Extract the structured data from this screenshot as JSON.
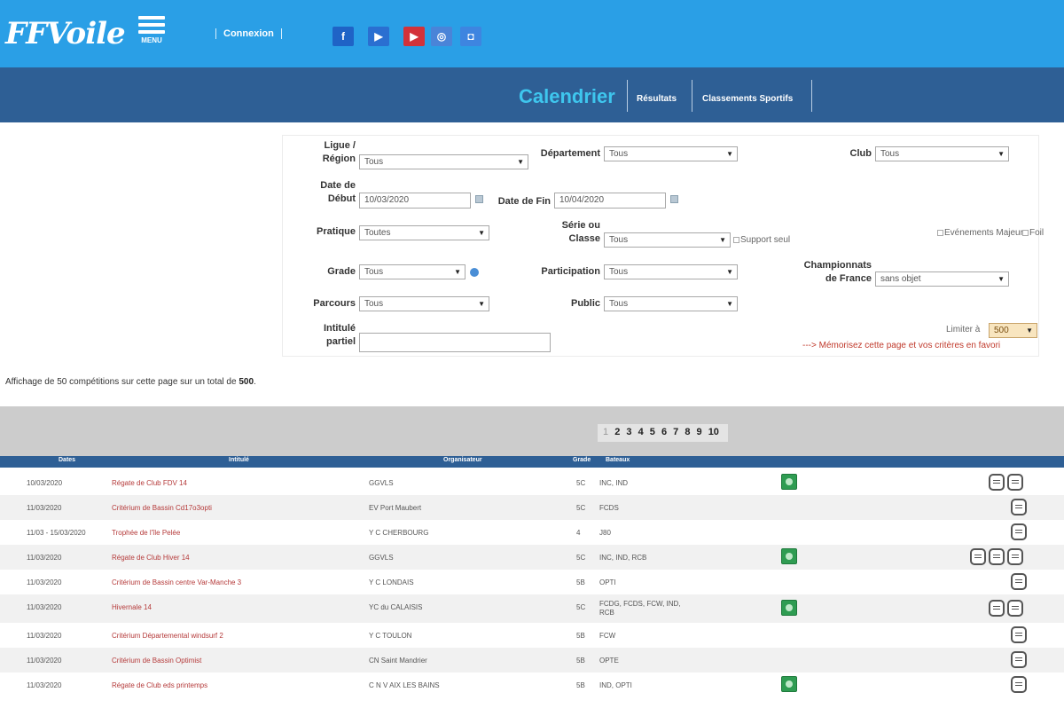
{
  "header": {
    "logo": "FFVoile",
    "menu_label": "MENU",
    "connexion": "Connexion",
    "social": [
      "f",
      "t",
      "yt",
      "ig",
      "dm"
    ]
  },
  "nav": {
    "calendrier": "Calendrier",
    "resultats": "Résultats",
    "classements": "Classements Sportifs"
  },
  "filters": {
    "ligue_label_1": "Ligue /",
    "ligue_label_2": "Région",
    "ligue_value": "Tous",
    "departement_label": "Département",
    "departement_value": "Tous",
    "club_label": "Club",
    "club_value": "Tous",
    "date_debut_label_1": "Date de",
    "date_debut_label_2": "Début",
    "date_debut_value": "10/03/2020",
    "date_fin_label": "Date de Fin",
    "date_fin_value": "10/04/2020",
    "pratique_label": "Pratique",
    "pratique_value": "Toutes",
    "serie_label_1": "Série ou",
    "serie_label_2": "Classe",
    "serie_value": "Tous",
    "support_seul": "Support seul",
    "evenements_majeurs": "Evénements Majeurs",
    "foil": "Foil",
    "grade_label": "Grade",
    "grade_value": "Tous",
    "participation_label": "Participation",
    "participation_value": "Tous",
    "championnats_label_1": "Championnats",
    "championnats_label_2": "de France",
    "championnats_value": "sans objet",
    "parcours_label": "Parcours",
    "parcours_value": "Tous",
    "public_label": "Public",
    "public_value": "Tous",
    "intitule_label_1": "Intitulé",
    "intitule_label_2": "partiel",
    "intitule_value": "",
    "limiter_label": "Limiter à",
    "limiter_value": "500",
    "memorisez": "---> Mémorisez cette page et vos critères en favori"
  },
  "summary": {
    "prefix": "Affichage de 50 compétitions sur cette page sur un total de",
    "total": "500",
    "suffix": "."
  },
  "pagination": [
    "1",
    "2",
    "3",
    "4",
    "5",
    "6",
    "7",
    "8",
    "9",
    "10"
  ],
  "table": {
    "headers": {
      "dates": "Dates",
      "intitule": "Intitulé",
      "organisateur": "Organisateur",
      "grade": "Grade",
      "bateaux": "Bateaux"
    },
    "rows": [
      {
        "date": "10/03/2020",
        "title": "Régate de Club FDV 14",
        "org": "GGVLS",
        "grade": "5C",
        "boats": "INC, IND"
      },
      {
        "date": "11/03/2020",
        "title": "Critérium de Bassin Cd17o3opti",
        "org": "EV Port Maubert",
        "grade": "5C",
        "boats": "FCDS"
      },
      {
        "date": "11/03 - 15/03/2020",
        "title": "Trophée de l'île Pelée",
        "org": "Y C CHERBOURG",
        "grade": "4",
        "boats": "J80"
      },
      {
        "date": "11/03/2020",
        "title": "Régate de Club Hiver 14",
        "org": "GGVLS",
        "grade": "5C",
        "boats": "INC, IND, RCB"
      },
      {
        "date": "11/03/2020",
        "title": "Critérium de Bassin centre Var-Manche 3",
        "org": "Y C LONDAIS",
        "grade": "5B",
        "boats": "OPTI"
      },
      {
        "date": "11/03/2020",
        "title": "Hivernale 14",
        "org": "YC du CALAISIS",
        "grade": "5C",
        "boats": "FCDG, FCDS, FCW, IND,",
        "boats2": "RCB"
      },
      {
        "date": "11/03/2020",
        "title": "Critérium Départemental windsurf 2",
        "org": "Y C TOULON",
        "grade": "5B",
        "boats": "FCW"
      },
      {
        "date": "11/03/2020",
        "title": "Critérium de Bassin Optimist",
        "org": "CN Saint Mandrier",
        "grade": "5B",
        "boats": "OPTE"
      },
      {
        "date": "11/03/2020",
        "title": "Régate de Club eds printemps",
        "org": "C N V AIX LES BAINS",
        "grade": "5B",
        "boats": "IND, OPTI"
      }
    ]
  },
  "colors": {
    "topbar": "#2a9fe6",
    "navbar": "#2e5f95",
    "accent_cyan": "#3ec6ee",
    "title_link": "#b53a3a"
  }
}
